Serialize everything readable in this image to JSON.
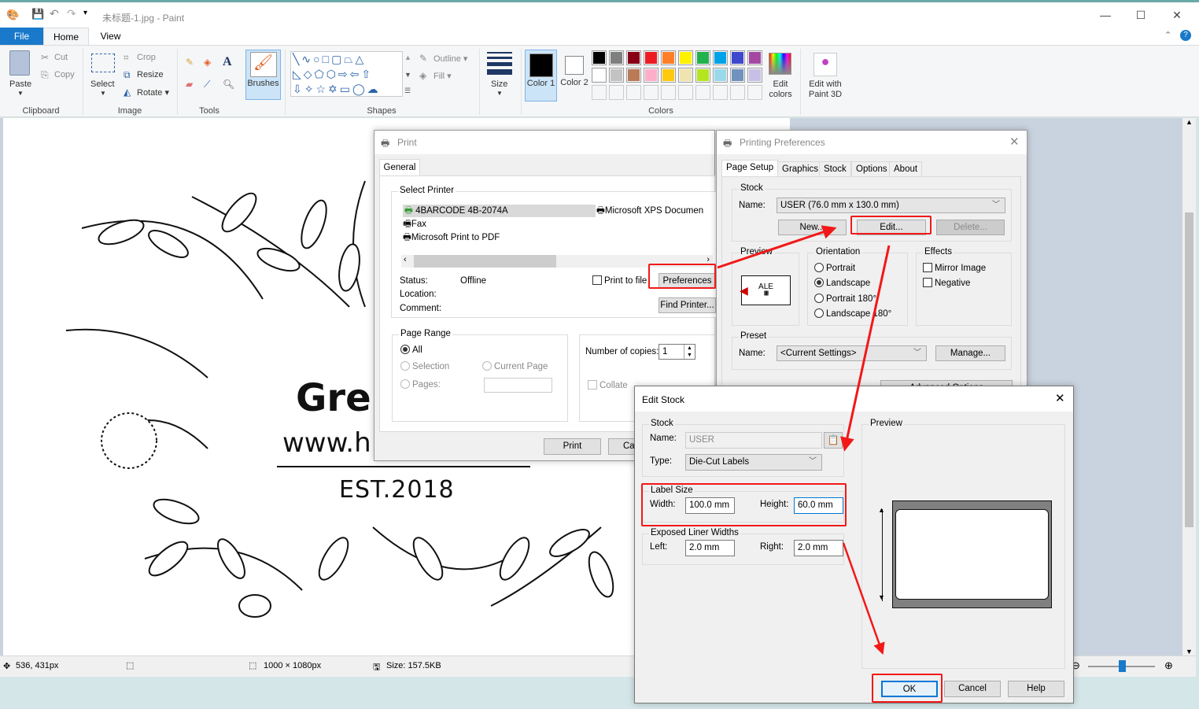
{
  "window": {
    "title": "未标题-1.jpg - Paint",
    "minimize": "—",
    "maximize": "☐",
    "close": "✕"
  },
  "ribbon_tabs": [
    {
      "label": "File"
    },
    {
      "label": "Home"
    },
    {
      "label": "View"
    }
  ],
  "clipboard": {
    "paste": "Paste",
    "cut": "Cut",
    "copy": "Copy",
    "group": "Clipboard"
  },
  "image": {
    "select": "Select",
    "crop": "Crop",
    "resize": "Resize",
    "rotate": "Rotate",
    "group": "Image"
  },
  "tools": {
    "group": "Tools",
    "brushes": "Brushes"
  },
  "shapes": {
    "group": "Shapes",
    "outline": "Outline",
    "fill": "Fill",
    "size": "Size"
  },
  "colors": {
    "group": "Colors",
    "color1": "Color 1",
    "color2": "Color 2",
    "edit_colors": "Edit colors",
    "paint3d": "Edit with Paint 3D",
    "palette": [
      "#000000",
      "#7f7f7f",
      "#880015",
      "#ed1c24",
      "#ff7f27",
      "#fff200",
      "#22b14c",
      "#00a2e8",
      "#3f48cc",
      "#a349a4",
      "#ffffff",
      "#c3c3c3",
      "#b97a57",
      "#ffaec9",
      "#ffc90e",
      "#efe4b0",
      "#b5e61d",
      "#99d9ea",
      "#7092be",
      "#c8bfe7"
    ]
  },
  "canvas_text": {
    "line1": "Gre",
    "line2": "www.h",
    "line3": "EST.2018"
  },
  "status": {
    "position": "536, 431px",
    "dimensions": "1000 × 1080px",
    "size": "Size: 157.5KB"
  },
  "print_dialog": {
    "title": "Print",
    "tab": "General",
    "select_printer": "Select Printer",
    "printers": [
      "4BARCODE 4B-2074A",
      "Fax",
      "Microsoft Print to PDF",
      "Microsoft XPS Documen"
    ],
    "status_label": "Status:",
    "status_value": "Offline",
    "location_label": "Location:",
    "comment_label": "Comment:",
    "print_to_file": "Print to file",
    "preferences": "Preferences",
    "find_printer": "Find Printer...",
    "page_range": "Page Range",
    "all": "All",
    "selection": "Selection",
    "current_page": "Current Page",
    "pages": "Pages:",
    "copies_label": "Number of copies:",
    "copies_value": "1",
    "collate": "Collate",
    "print": "Print",
    "cancel": "Ca"
  },
  "prefs_dialog": {
    "title": "Printing Preferences",
    "tabs": [
      "Page Setup",
      "Graphics",
      "Stock",
      "Options",
      "About"
    ],
    "stock": "Stock",
    "name_label": "Name:",
    "stock_name": "USER (76.0 mm x 130.0 mm)",
    "new": "New...",
    "edit": "Edit...",
    "delete": "Delete...",
    "preview": "Preview",
    "preview_text": "ALE",
    "orientation": "Orientation",
    "orientations": [
      "Portrait",
      "Landscape",
      "Portrait 180°",
      "Landscape 180°"
    ],
    "selected_orientation": "Landscape",
    "effects": "Effects",
    "mirror": "Mirror Image",
    "negative": "Negative",
    "preset": "Preset",
    "preset_name": "<Current Settings>",
    "manage": "Manage...",
    "advanced": "Advanced Options"
  },
  "edit_stock": {
    "title": "Edit Stock",
    "stock": "Stock",
    "name_label": "Name:",
    "name_value": "USER",
    "type_label": "Type:",
    "type_value": "Die-Cut Labels",
    "label_size": "Label Size",
    "width_label": "Width:",
    "width_value": "100.0 mm",
    "height_label": "Height:",
    "height_value": "60.0 mm",
    "liner": "Exposed Liner Widths",
    "left_label": "Left:",
    "left_value": "2.0 mm",
    "right_label": "Right:",
    "right_value": "2.0 mm",
    "preview": "Preview",
    "ok": "OK",
    "cancel": "Cancel",
    "help": "Help"
  },
  "annotation_color": "#f21818"
}
